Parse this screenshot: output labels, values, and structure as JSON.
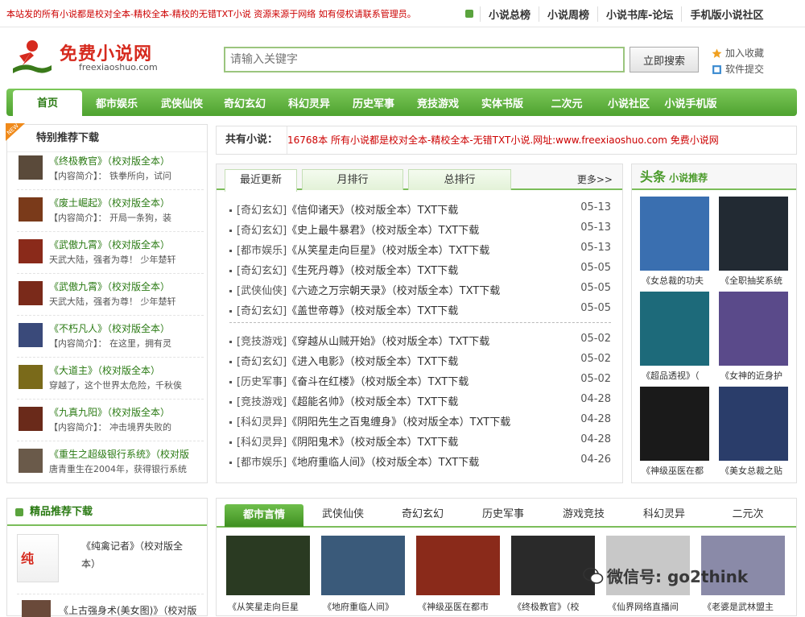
{
  "top": {
    "notice": "本站发的所有小说都是校对全本-精校全本-精校的无错TXT小说 资源来源于网络 如有侵权请联系管理员。",
    "links": [
      "小说总榜",
      "小说周榜",
      "小说书库-论坛",
      "手机版小说社区"
    ]
  },
  "logo": {
    "name": "免费小说网",
    "domain": "freexiaoshuo.com"
  },
  "search": {
    "placeholder": "请输入关键字",
    "button": "立即搜索"
  },
  "side_links": {
    "bookmark": "加入收藏",
    "submit": "软件提交"
  },
  "nav": [
    "首页",
    "都市娱乐",
    "武侠仙侠",
    "奇幻玄幻",
    "科幻灵异",
    "历史军事",
    "竞技游戏",
    "实体书版",
    "二次元",
    "小说社区",
    "小说手机版"
  ],
  "special": {
    "title": "特别推荐下载",
    "items": [
      {
        "title": "《终极教官》（校对版全本）",
        "desc": "【内容简介】： 铁拳所向，试问"
      },
      {
        "title": "《废土崛起》（校对版全本）",
        "desc": "【内容简介】： 开局一条狗，装"
      },
      {
        "title": "《武傲九霄》（校对版全本）",
        "desc": "天武大陆，强者为尊！ 少年楚轩"
      },
      {
        "title": "《武傲九霄》（校对版全本）",
        "desc": "天武大陆，强者为尊！ 少年楚轩"
      },
      {
        "title": "《不朽凡人》（校对版全本）",
        "desc": "【内容简介】： 在这里，拥有灵"
      },
      {
        "title": "《大道主》（校对版全本）",
        "desc": "穿越了，这个世界太危险，千秋俟"
      },
      {
        "title": "《九真九阳》（校对版全本）",
        "desc": "【内容简介】： 冲击境界失败的"
      },
      {
        "title": "《重生之超级银行系统》（校对版",
        "desc": "唐青重生在2004年，获得银行系统"
      }
    ]
  },
  "count": {
    "label": "共有小说：",
    "text": "16768本 所有小说都是校对全本-精校全本-无错TXT小说.网址:www.freexiaoshuo.com 免费小说网"
  },
  "updates": {
    "tabs": [
      "最近更新",
      "月排行",
      "总排行"
    ],
    "more": "更多>>",
    "group1": [
      {
        "cat": "[奇幻玄幻]",
        "title": "《信仰诸天》（校对版全本）TXT下载",
        "date": "05-13"
      },
      {
        "cat": "[奇幻玄幻]",
        "title": "《史上最牛暴君》（校对版全本）TXT下载",
        "date": "05-13"
      },
      {
        "cat": "[都市娱乐]",
        "title": "《从笑星走向巨星》（校对版全本）TXT下载",
        "date": "05-13"
      },
      {
        "cat": "[奇幻玄幻]",
        "title": "《生死丹尊》（校对版全本）TXT下载",
        "date": "05-05"
      },
      {
        "cat": "[武侠仙侠]",
        "title": "《六迹之万宗朝天录》（校对版全本）TXT下载",
        "date": "05-05"
      },
      {
        "cat": "[奇幻玄幻]",
        "title": "《盖世帝尊》（校对版全本）TXT下载",
        "date": "05-05"
      }
    ],
    "group2": [
      {
        "cat": "[竞技游戏]",
        "title": "《穿越从山贼开始》（校对版全本）TXT下载",
        "date": "05-02"
      },
      {
        "cat": "[奇幻玄幻]",
        "title": "《进入电影》（校对版全本）TXT下载",
        "date": "05-02"
      },
      {
        "cat": "[历史军事]",
        "title": "《奋斗在红楼》（校对版全本）TXT下载",
        "date": "05-02"
      },
      {
        "cat": "[竞技游戏]",
        "title": "《超能名帅》（校对版全本）TXT下载",
        "date": "04-28"
      },
      {
        "cat": "[科幻灵异]",
        "title": "《阴阳先生之百鬼缠身》（校对版全本）TXT下载",
        "date": "04-28"
      },
      {
        "cat": "[科幻灵异]",
        "title": "《阴阳鬼术》（校对版全本）TXT下载",
        "date": "04-28"
      },
      {
        "cat": "[都市娱乐]",
        "title": "《地府重临人间》（校对版全本）TXT下载",
        "date": "04-26"
      }
    ]
  },
  "headline": {
    "title_big": "头条",
    "title_small": "小说推荐",
    "books": [
      "《女总裁的功夫",
      "《全职抽奖系统",
      "《超品透视》（",
      "《女神的近身护",
      "《神级巫医在都",
      "《美女总裁之贴"
    ],
    "cover_colors": [
      "#3a6fb0",
      "#222a33",
      "#1d6a7a",
      "#5a4a8a",
      "#1a1a1a",
      "#2a3d6a"
    ]
  },
  "quality": {
    "title": "精品推荐下载",
    "items": [
      "《纯禽记者》（校对版全本）",
      "《上古强身术(美女图)》（校对版"
    ]
  },
  "bottom": {
    "tabs": [
      "都市言情",
      "武侠仙侠",
      "奇幻玄幻",
      "历史军事",
      "游戏竞技",
      "科幻灵异",
      "二元次"
    ],
    "books": [
      "《从笑星走向巨星",
      "《地府重临人间》",
      "《神级巫医在都市",
      "《终极教官》（校",
      "《仙界网络直播间",
      "《老婆是武林盟主"
    ],
    "cover_colors": [
      "#2a3a22",
      "#3a5a7a",
      "#8a2a1a",
      "#2a2a2a",
      "#c8c8c8",
      "#8a8aa8"
    ]
  },
  "watermark": "微信号: go2think",
  "colors": {
    "green": "#4ea22f",
    "red": "#c00000"
  }
}
